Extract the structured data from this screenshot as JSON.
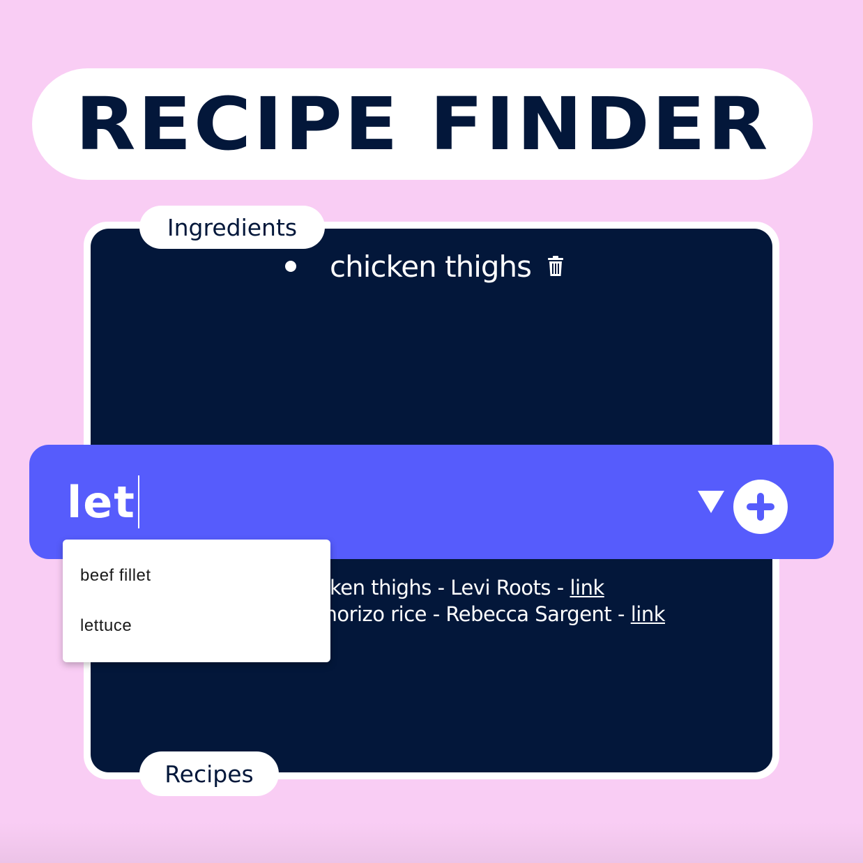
{
  "header": {
    "title": "RECIPE FINDER"
  },
  "ingredients": {
    "label": "Ingredients",
    "items": [
      {
        "name": "chicken thighs"
      }
    ]
  },
  "recipes": {
    "label": "Recipes",
    "items": [
      {
        "text": "icken thighs - Levi Roots - ",
        "link_label": "link"
      },
      {
        "text": "chorizo rice - Rebecca Sargent - ",
        "link_label": "link"
      }
    ]
  },
  "search": {
    "value": "let",
    "suggestions": [
      "beef fillet",
      "lettuce"
    ]
  },
  "icons": {
    "delete": "trash-icon",
    "dropdown": "caret-down-icon",
    "add": "plus-circle-icon"
  },
  "colors": {
    "background": "#f9cdf4",
    "panel": "#03173a",
    "search_bar": "#565cfc",
    "white": "#ffffff"
  }
}
